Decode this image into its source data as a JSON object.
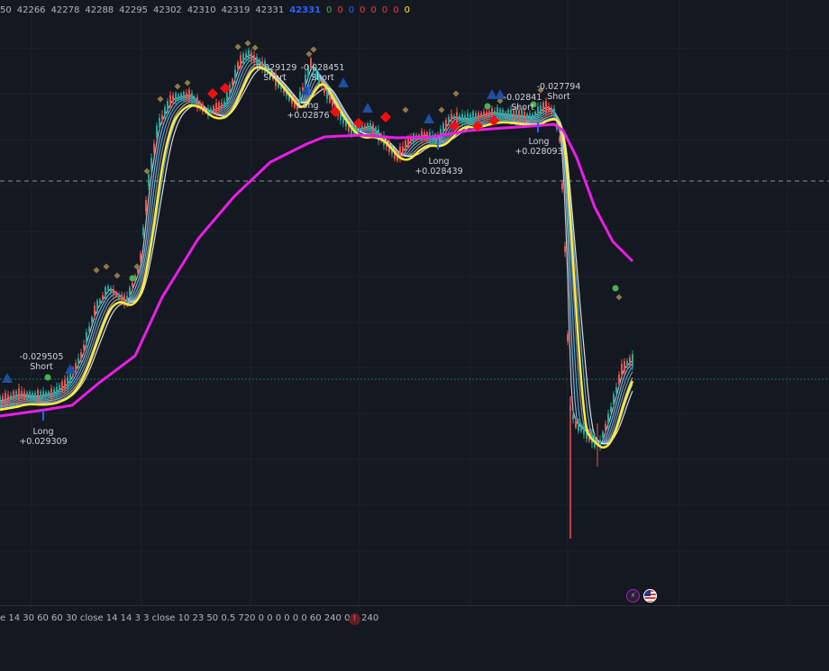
{
  "status": {
    "values": [
      "50",
      "42266",
      "42278",
      "42288",
      "42295",
      "42302",
      "42310",
      "42319",
      "42331",
      "42331",
      "0",
      "0",
      "0",
      "0",
      "0",
      "0",
      "0",
      "0"
    ],
    "colors": [
      "#b2b5be",
      "#b2b5be",
      "#b2b5be",
      "#b2b5be",
      "#b2b5be",
      "#b2b5be",
      "#b2b5be",
      "#b2b5be",
      "#b2b5be",
      "#2962ff",
      "#4caf50",
      "#f23645",
      "#2962ff",
      "#f23645",
      "#f23645",
      "#f23645",
      "#f23645",
      "#ffeb3b"
    ]
  },
  "trade_labels": [
    {
      "value": "-0.029505",
      "side": "Short"
    },
    {
      "value": "+0.029309",
      "side": "Long"
    },
    {
      "value": "-0.029129",
      "side": "Short"
    },
    {
      "value": "-0.028451",
      "side": "Short"
    },
    {
      "value": "+0.02876",
      "side": "Long"
    },
    {
      "value": "+0.028439",
      "side": "Long"
    },
    {
      "value": "-0.02841",
      "side": "Short"
    },
    {
      "value": "-0.027794",
      "side": "Short"
    },
    {
      "value": "+0.028093",
      "side": "Long"
    }
  ],
  "bottom_bar": {
    "params_text": "e 14 30 60 60 30 close 14 14 3 3 close 10 23 50 0.5 720 0 0 0 0 0 0 60 240 0 0 240",
    "alert_glyph": "!"
  },
  "icons": {
    "bolt": "⚡"
  },
  "colors": {
    "background": "#141821",
    "yellow_ma": "#ffeb3b",
    "magenta_ma": "#e91ee6",
    "candle_up": "#26a69a",
    "candle_down": "#ef5350",
    "short_marker": "#f20f0f",
    "long_marker": "#2962ff"
  }
}
